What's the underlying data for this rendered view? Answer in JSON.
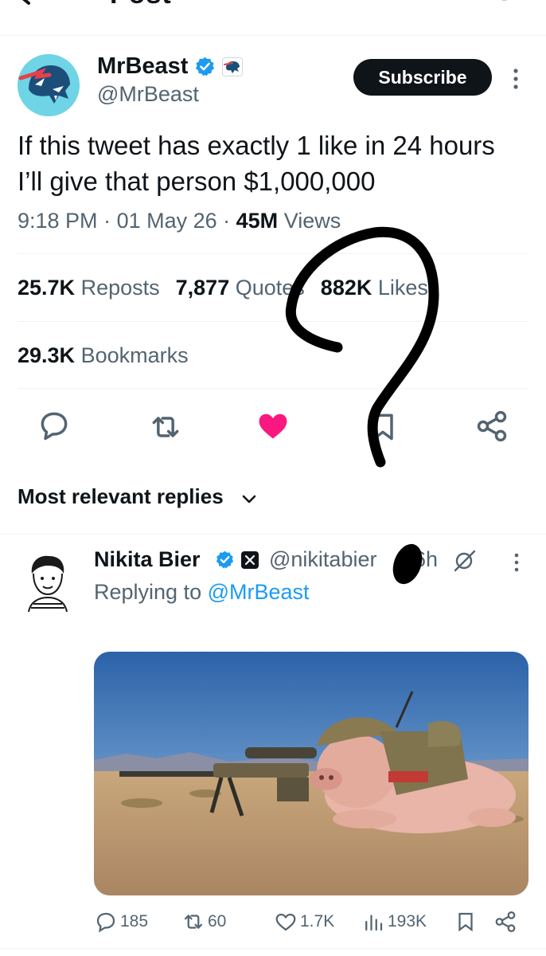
{
  "header": {
    "title": "Post",
    "back_icon": "arrow-left-icon",
    "right_icon": "reply-settings-icon"
  },
  "author": {
    "name": "MrBeast",
    "handle": "@MrBeast",
    "verified_icon": "verified-badge-icon",
    "affiliate_icon": "beast-logo-icon",
    "subscribe_label": "Subscribe"
  },
  "tweet": {
    "text": "If this tweet has exactly 1 like in 24 hours I’ll give that person $1,000,000",
    "time": "9:18 PM",
    "date": "01 May 26",
    "views_count": "45M",
    "views_label": "Views",
    "separator": " · "
  },
  "stats": {
    "reposts_count": "25.7K",
    "reposts_label": "Reposts",
    "quotes_count": "7,877",
    "quotes_label": "Quotes",
    "likes_count": "882K",
    "likes_label": "Likes",
    "bookmarks_count": "29.3K",
    "bookmarks_label": "Bookmarks"
  },
  "actions": {
    "icons": [
      "reply-icon",
      "repost-icon",
      "like-icon",
      "bookmark-icon",
      "share-icon"
    ],
    "liked": true
  },
  "replies": {
    "sort_label": "Most relevant replies"
  },
  "reply": {
    "name": "Nikita Bier",
    "handle": "@nikitabier",
    "time": "6h",
    "replying_prefix": "Replying to",
    "replying_to": "@MrBeast",
    "media_icon": "sniper-pig-photo",
    "reply_count": "185",
    "repost_count": "60",
    "like_count": "1.7K",
    "view_count": "193K"
  },
  "colors": {
    "text": "#0f1419",
    "secondary": "#536471",
    "accent": "#1d9bf0",
    "like": "#f91880",
    "subscribe_bg": "#0f1419",
    "divider": "#eff3f4"
  }
}
